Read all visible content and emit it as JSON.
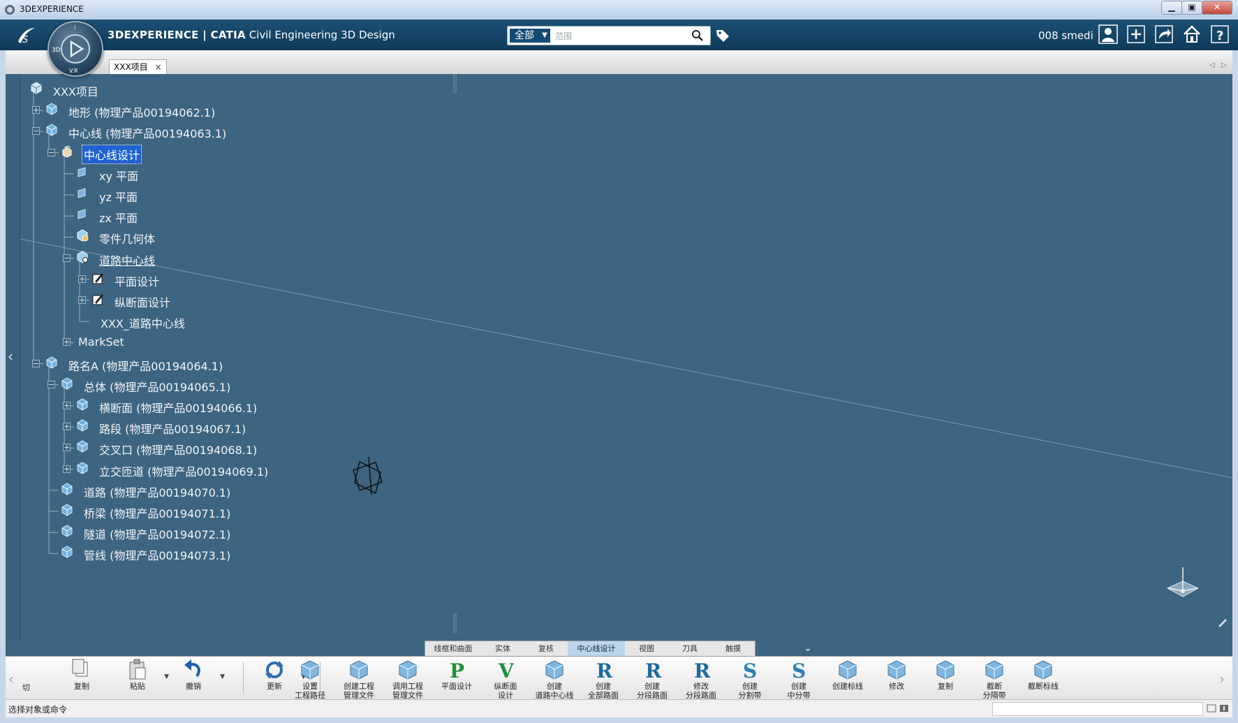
{
  "window": {
    "title": "3DEXPERIENCE",
    "minimize": "▁",
    "maximize": "▣",
    "close": "✕"
  },
  "header": {
    "brand_prefix": "3DEXPERIENCE | ",
    "brand_catia": "CATIA",
    "brand_app": " Civil Engineering 3D Design",
    "search_scope": "全部",
    "search_placeholder": "范围",
    "user_name": "008 smedi",
    "compass_labels": {
      "left": "3D",
      "bottom": "V.R",
      "top": "i"
    }
  },
  "document_tab": {
    "label": "XXX项目",
    "close": "×"
  },
  "tree": {
    "nodes": [
      {
        "label": "XXX项目"
      },
      {
        "label": "地形 (物理产品00194062.1)"
      },
      {
        "label": "中心线 (物理产品00194063.1)"
      },
      {
        "label": "中心线设计"
      },
      {
        "label": "xy 平面"
      },
      {
        "label": "yz 平面"
      },
      {
        "label": "zx 平面"
      },
      {
        "label": "零件几何体"
      },
      {
        "label": "道路中心线"
      },
      {
        "label": "平面设计"
      },
      {
        "label": "纵断面设计"
      },
      {
        "label": "XXX_道路中心线"
      },
      {
        "label": "MarkSet"
      },
      {
        "label": "路名A (物理产品00194064.1)"
      },
      {
        "label": "总体 (物理产品00194065.1)"
      },
      {
        "label": "横断面 (物理产品00194066.1)"
      },
      {
        "label": "路段 (物理产品00194067.1)"
      },
      {
        "label": "交叉口 (物理产品00194068.1)"
      },
      {
        "label": "立交匝道 (物理产品00194069.1)"
      },
      {
        "label": "道路 (物理产品00194070.1)"
      },
      {
        "label": "桥梁 (物理产品00194071.1)"
      },
      {
        "label": "隧道 (物理产品00194072.1)"
      },
      {
        "label": "管线 (物理产品00194073.1)"
      }
    ],
    "expander_plus": "+",
    "expander_minus": "−"
  },
  "section_tabs": [
    {
      "label": "线框和曲面"
    },
    {
      "label": "实体"
    },
    {
      "label": "复核"
    },
    {
      "label": "中心线设计",
      "active": true
    },
    {
      "label": "视图"
    },
    {
      "label": "刀具"
    },
    {
      "label": "触摸"
    }
  ],
  "action_bar": {
    "standard": [
      {
        "label": "复制",
        "icon": "copy-icon"
      },
      {
        "label": "粘贴",
        "icon": "paste-icon"
      },
      {
        "label": "撤销",
        "icon": "undo-icon"
      },
      {
        "label": "更新",
        "icon": "update-icon"
      }
    ],
    "partial_left_label": "切",
    "commands": [
      {
        "label": "设置\n工程路径",
        "icon": "set-project-path-icon"
      },
      {
        "label": "创建工程\n管理文件",
        "icon": "create-project-file-icon"
      },
      {
        "label": "调用工程\n管理文件",
        "icon": "load-project-file-icon"
      },
      {
        "label": "平面设计",
        "icon": "plan-design-icon",
        "glyph": "P"
      },
      {
        "label": "纵断面\n设计",
        "icon": "profile-design-icon",
        "glyph": "V"
      },
      {
        "label": "创建\n道路中心线",
        "icon": "create-centerline-icon"
      },
      {
        "label": "创建\n全部路面",
        "icon": "create-all-pavement-icon",
        "glyph": "R"
      },
      {
        "label": "创建\n分段路面",
        "icon": "create-segment-pavement-icon",
        "glyph": "R"
      },
      {
        "label": "修改\n分段路面",
        "icon": "modify-segment-pavement-icon",
        "glyph": "R"
      },
      {
        "label": "创建\n分割带",
        "icon": "create-divider-icon",
        "glyph": "S"
      },
      {
        "label": "创建\n中分带",
        "icon": "create-median-icon",
        "glyph": "S"
      },
      {
        "label": "创建标线",
        "icon": "create-marking-icon"
      },
      {
        "label": "修改",
        "icon": "modify-icon"
      },
      {
        "label": "复制",
        "icon": "copy-command-icon"
      },
      {
        "label": "截断\n分隔带",
        "icon": "cut-divider-icon"
      },
      {
        "label": "截断标线",
        "icon": "cut-marking-icon"
      }
    ]
  },
  "status": {
    "text": "选择对象或命令"
  },
  "colors": {
    "viewport_bg": "#3d6480",
    "header_bg": "#134466",
    "selection": "#1f62d0",
    "active_section_tab": "#bcd5ea"
  }
}
